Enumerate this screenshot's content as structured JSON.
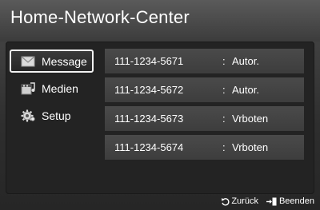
{
  "window": {
    "title": "Home-Network-Center"
  },
  "sidebar": {
    "items": [
      {
        "label": "Message",
        "icon": "envelope-icon",
        "selected": true
      },
      {
        "label": "Medien",
        "icon": "film-music-icon",
        "selected": false
      },
      {
        "label": "Setup",
        "icon": "gear-icon",
        "selected": false
      }
    ]
  },
  "list": {
    "rows": [
      {
        "number": "111-1234-5671",
        "separator": ":",
        "status": "Autor."
      },
      {
        "number": "111-1234-5672",
        "separator": ":",
        "status": "Autor."
      },
      {
        "number": "111-1234-5673",
        "separator": ":",
        "status": "Vrboten"
      },
      {
        "number": "111-1234-5674",
        "separator": ":",
        "status": "Vrboten"
      }
    ]
  },
  "footer": {
    "back_label": "Zurück",
    "back_icon": "return-icon",
    "exit_label": "Beenden",
    "exit_icon": "exit-icon"
  },
  "colors": {
    "row_bg": "#444444",
    "panel_bg": "#232323",
    "text": "#ffffff"
  }
}
